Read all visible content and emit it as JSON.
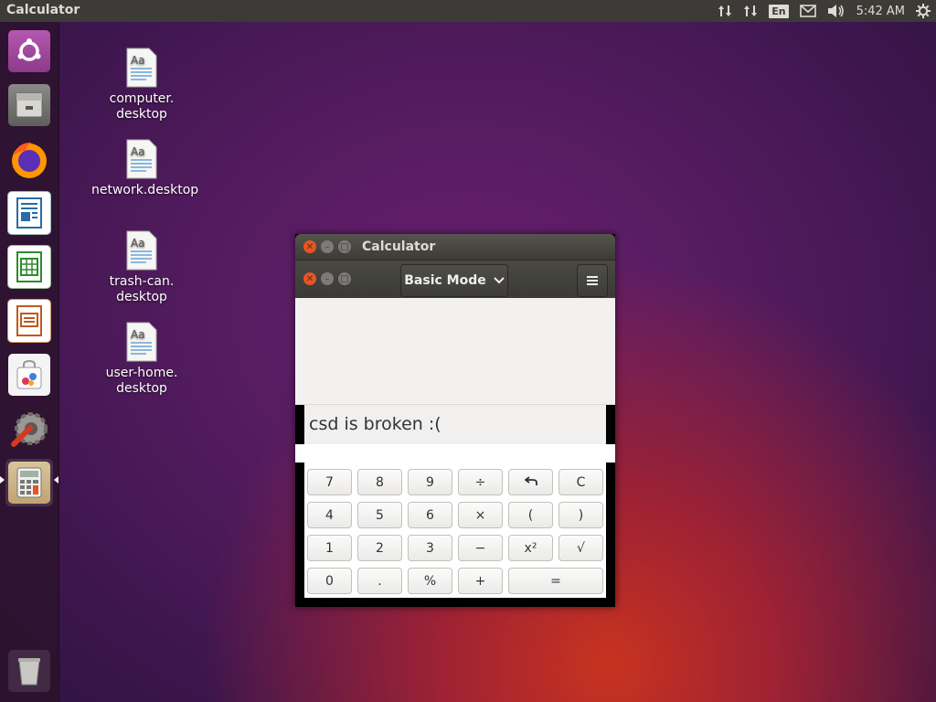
{
  "top_panel": {
    "app_title": "Calculator",
    "lang": "En",
    "clock": "5:42 AM",
    "icons": [
      "network-updown-icon",
      "network-updown-icon",
      "keyboard-lang-icon",
      "mail-icon",
      "volume-icon",
      "system-gear-icon"
    ]
  },
  "launcher": {
    "items": [
      "ubuntu-dash",
      "files",
      "firefox",
      "libreoffice-writer",
      "libreoffice-calc",
      "libreoffice-impress",
      "software-center",
      "system-settings",
      "calculator",
      "trash"
    ],
    "active": "calculator"
  },
  "desktop": {
    "icons": [
      {
        "line1": "computer.",
        "line2": "desktop"
      },
      {
        "line1": "network.desktop",
        "line2": ""
      },
      {
        "line1": "trash-can.",
        "line2": "desktop"
      },
      {
        "line1": "user-home.",
        "line2": "desktop"
      }
    ]
  },
  "calculator": {
    "window_title": "Calculator",
    "mode_label": "Basic Mode",
    "display_text": "csd is broken :(",
    "keys": [
      [
        "7",
        "8",
        "9",
        "÷",
        "↶",
        "C"
      ],
      [
        "4",
        "5",
        "6",
        "×",
        "(",
        ")"
      ],
      [
        "1",
        "2",
        "3",
        "−",
        "x²",
        "√"
      ],
      [
        "0",
        ".",
        "%",
        "+",
        "="
      ]
    ]
  },
  "colors": {
    "panel": "#3c3b37",
    "accent_close": "#e95420",
    "wallpaper_purple": "#571c62"
  }
}
